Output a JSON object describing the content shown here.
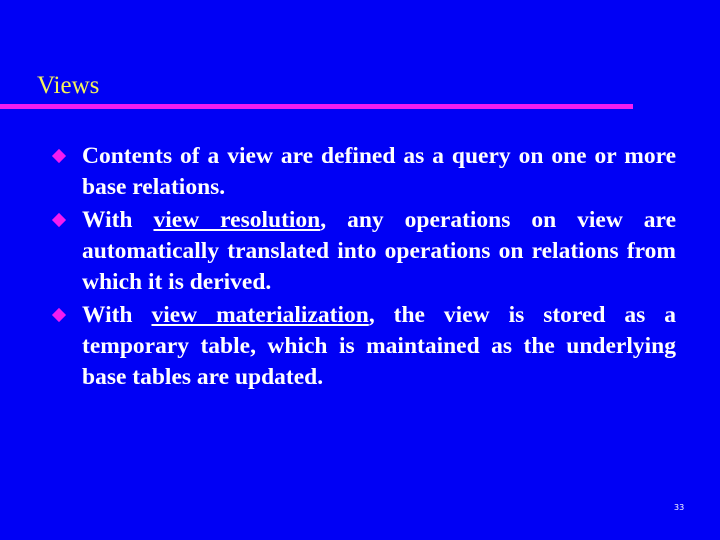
{
  "slide": {
    "title": "Views",
    "page_number": "33",
    "colors": {
      "background": "#0000f5",
      "title": "#f5f35a",
      "accent": "#f31cf0",
      "text": "#ffffff"
    },
    "bullets": [
      {
        "icon": "diamond-bullet-icon",
        "before": "Contents of a view are defined as a query on one or more base relations.",
        "underlined": "",
        "after": ""
      },
      {
        "icon": "diamond-bullet-icon",
        "before": "With ",
        "underlined": "view resolution",
        "after": ", any operations on view are automatically translated into operations on relations from which it is derived."
      },
      {
        "icon": "diamond-bullet-icon",
        "before": "With ",
        "underlined": "view materialization",
        "after": ", the view is stored as a temporary table, which is maintained as the underlying base tables are updated."
      }
    ]
  }
}
